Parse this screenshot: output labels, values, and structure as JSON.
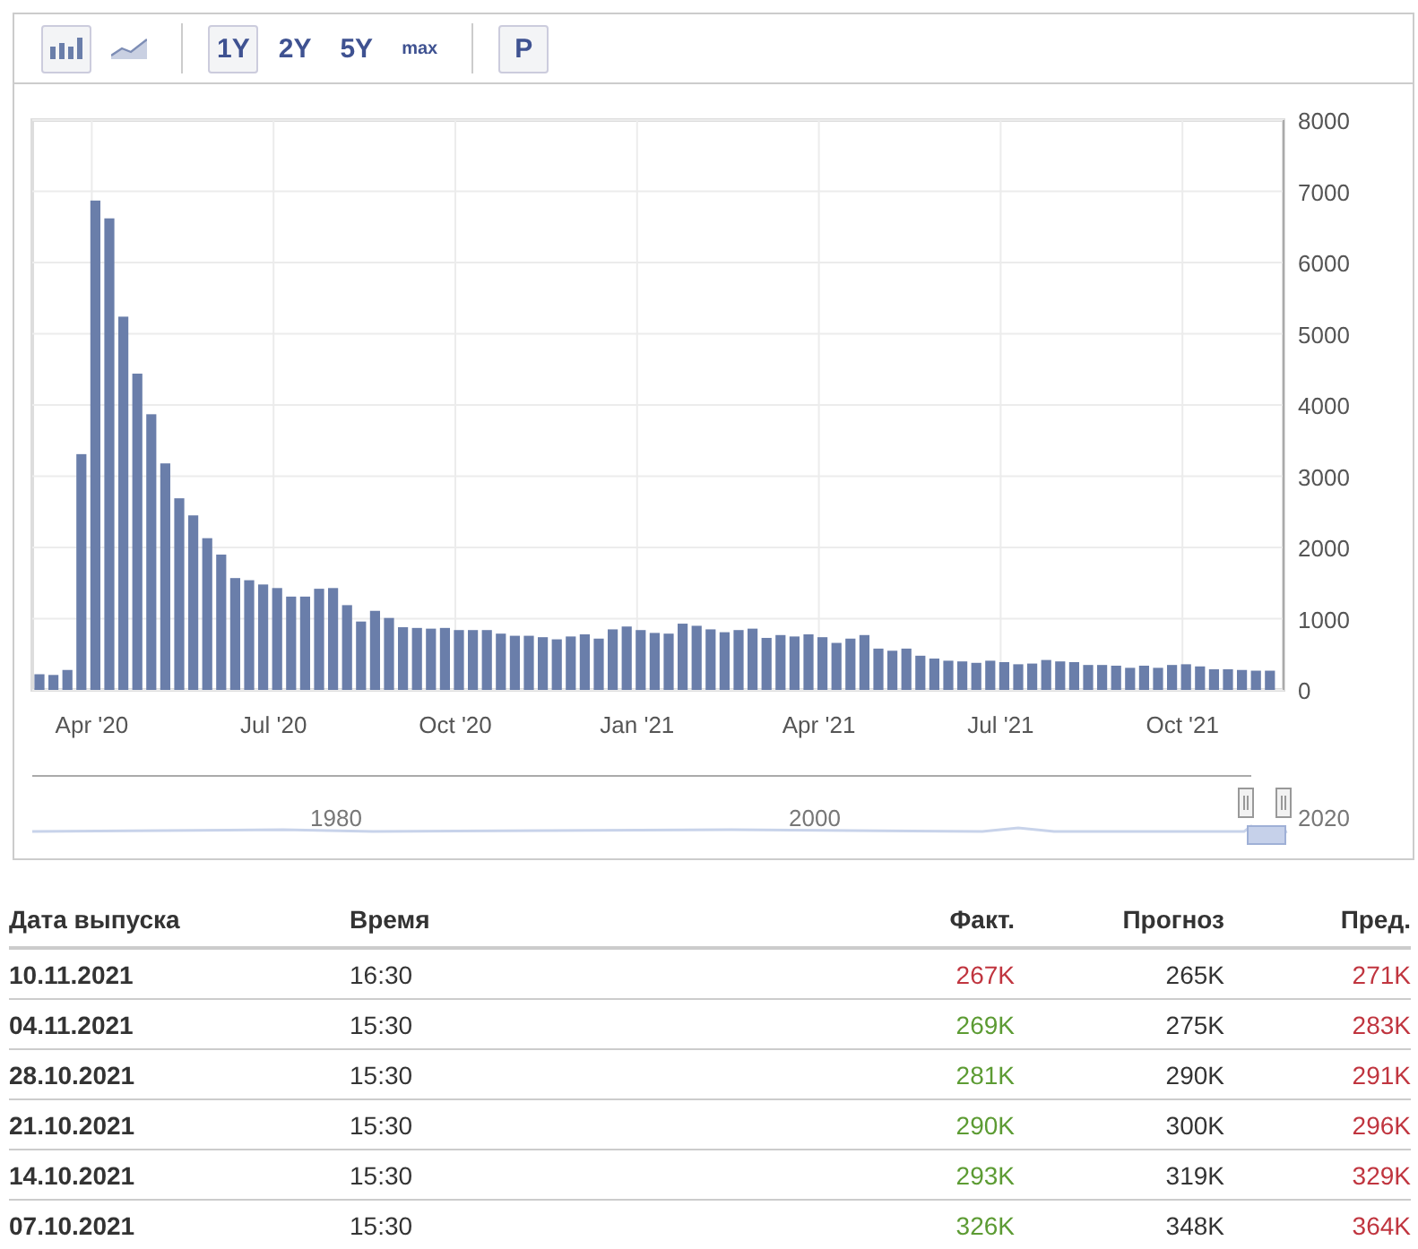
{
  "toolbar": {
    "chart_types": [
      {
        "kind": "bar",
        "selected": true
      },
      {
        "kind": "area",
        "selected": false
      }
    ],
    "ranges": [
      {
        "label": "1Y",
        "selected": true
      },
      {
        "label": "2Y",
        "selected": false
      },
      {
        "label": "5Y",
        "selected": false
      },
      {
        "label": "max",
        "selected": false
      }
    ],
    "p_button": "P"
  },
  "chart": {
    "chart_data": {
      "type": "bar",
      "categories": [
        null,
        null,
        null,
        null,
        "Apr '20",
        null,
        null,
        null,
        null,
        null,
        null,
        null,
        null,
        null,
        null,
        null,
        null,
        "Jul '20",
        null,
        null,
        null,
        null,
        null,
        null,
        null,
        null,
        null,
        null,
        null,
        null,
        "Oct '20",
        null,
        null,
        null,
        null,
        null,
        null,
        null,
        null,
        null,
        null,
        null,
        null,
        "Jan '21",
        null,
        null,
        null,
        null,
        null,
        null,
        null,
        null,
        null,
        null,
        null,
        null,
        "Apr '21",
        null,
        null,
        null,
        null,
        null,
        null,
        null,
        null,
        null,
        null,
        null,
        null,
        "Jul '21",
        null,
        null,
        null,
        null,
        null,
        null,
        null,
        null,
        null,
        null,
        null,
        null,
        "Oct '21",
        null,
        null,
        null,
        null,
        null,
        null
      ],
      "series": [
        {
          "color": "#6a7eaa",
          "values": [
            220,
            210,
            280,
            3310,
            6870,
            6620,
            5240,
            4440,
            3870,
            3180,
            2690,
            2450,
            2130,
            1900,
            1570,
            1540,
            1480,
            1430,
            1310,
            1310,
            1420,
            1430,
            1190,
            960,
            1110,
            1010,
            880,
            870,
            860,
            870,
            840,
            840,
            840,
            790,
            760,
            760,
            740,
            710,
            750,
            780,
            720,
            850,
            890,
            840,
            800,
            790,
            930,
            900,
            850,
            810,
            840,
            860,
            730,
            770,
            750,
            780,
            740,
            660,
            720,
            770,
            580,
            550,
            580,
            480,
            440,
            410,
            400,
            380,
            410,
            390,
            360,
            370,
            420,
            400,
            390,
            350,
            350,
            340,
            310,
            340,
            310,
            350,
            360,
            330,
            290,
            290,
            280,
            270,
            270
          ]
        }
      ],
      "grid": true,
      "ylim": [
        0,
        8000
      ],
      "yticks": [
        0,
        1000,
        2000,
        3000,
        4000,
        5000,
        6000,
        7000,
        8000
      ]
    }
  },
  "navigator": {
    "labels": [
      "1980",
      "2000",
      "2020"
    ]
  },
  "table": {
    "columns": [
      "Дата выпуска",
      "Время",
      "Факт.",
      "Прогноз",
      "Пред."
    ],
    "rows": [
      {
        "date": "10.11.2021",
        "time": "16:30",
        "actual": {
          "text": "267K",
          "color": "#c0353f"
        },
        "forecast": "265K",
        "previous": {
          "text": "271K",
          "color": "#c0353f"
        }
      },
      {
        "date": "04.11.2021",
        "time": "15:30",
        "actual": {
          "text": "269K",
          "color": "#5c9b33"
        },
        "forecast": "275K",
        "previous": {
          "text": "283K",
          "color": "#c0353f"
        }
      },
      {
        "date": "28.10.2021",
        "time": "15:30",
        "actual": {
          "text": "281K",
          "color": "#5c9b33"
        },
        "forecast": "290K",
        "previous": {
          "text": "291K",
          "color": "#c0353f"
        }
      },
      {
        "date": "21.10.2021",
        "time": "15:30",
        "actual": {
          "text": "290K",
          "color": "#5c9b33"
        },
        "forecast": "300K",
        "previous": {
          "text": "296K",
          "color": "#c0353f"
        }
      },
      {
        "date": "14.10.2021",
        "time": "15:30",
        "actual": {
          "text": "293K",
          "color": "#5c9b33"
        },
        "forecast": "319K",
        "previous": {
          "text": "329K",
          "color": "#c0353f"
        }
      },
      {
        "date": "07.10.2021",
        "time": "15:30",
        "actual": {
          "text": "326K",
          "color": "#5c9b33"
        },
        "forecast": "348K",
        "previous": {
          "text": "364K",
          "color": "#c0353f"
        }
      }
    ]
  }
}
